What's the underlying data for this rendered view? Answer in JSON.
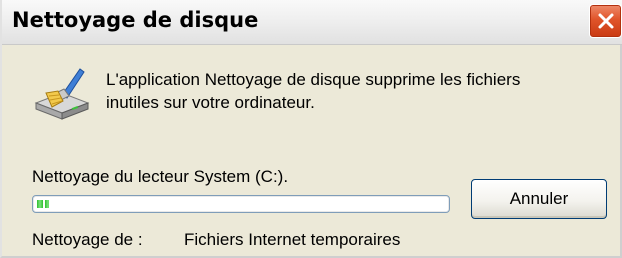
{
  "window": {
    "title": "Nettoyage de disque"
  },
  "dialog": {
    "description_line1": "L'application Nettoyage de disque supprime les fichiers",
    "description_line2": "inutiles sur votre ordinateur.",
    "status_text": "Nettoyage du lecteur System (C:).",
    "progress_fraction": 0.03,
    "cancel_label": "Annuler",
    "cleaning_label": "Nettoyage de :",
    "cleaning_value": "Fichiers Internet temporaires"
  },
  "icons": {
    "app": "disk-cleanup-icon",
    "close": "close-icon"
  },
  "colors": {
    "close_button": "#e0542a",
    "progress_fill": "#2fbf2f",
    "button_border": "#003c74"
  }
}
